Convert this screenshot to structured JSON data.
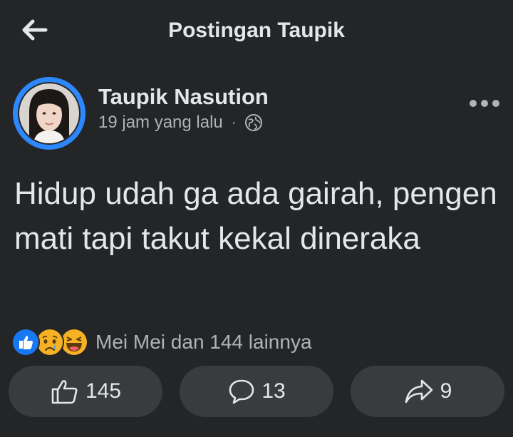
{
  "header": {
    "title": "Postingan Taupik"
  },
  "post": {
    "author": "Taupik Nasution",
    "time": "19 jam yang lalu",
    "separator": "·",
    "text": "Hidup udah ga ada gairah, pengen mati tapi takut kekal dineraka"
  },
  "reactions": {
    "icons": [
      "like-icon",
      "sad-icon",
      "haha-icon"
    ],
    "summary": "Mei Mei dan 144 lainnya"
  },
  "actions": {
    "like_count": "145",
    "comment_count": "13",
    "share_count": "9"
  },
  "colors": {
    "background": "#242526",
    "button": "#3a3b3c",
    "accent": "#2d88ff",
    "text": "#e4e6eb",
    "muted": "#b0b3b8"
  }
}
